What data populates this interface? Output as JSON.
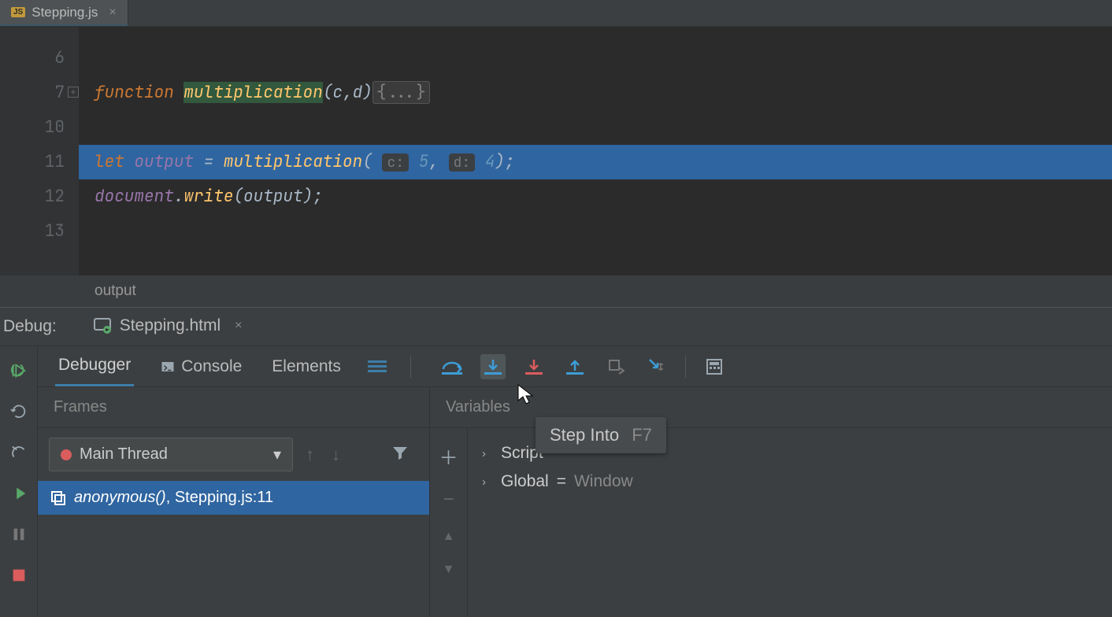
{
  "editor": {
    "tab": {
      "filename": "Stepping.js"
    },
    "lines": [
      {
        "num": "6"
      },
      {
        "num": "7"
      },
      {
        "num": "10"
      },
      {
        "num": "11"
      },
      {
        "num": "12"
      },
      {
        "num": "13"
      }
    ],
    "tokens": {
      "function_kw": "function",
      "fn_name": "multiplication",
      "fn_params": "(c,d)",
      "fold": "{...}",
      "let_kw": "let",
      "output_var": "output",
      "eq": " = ",
      "call_name": "multiplication",
      "open": "(",
      "hint_c": "c:",
      "arg1": "5",
      "comma": ",",
      "hint_d": "d:",
      "arg2": "4",
      "close_semi": ");",
      "document": "document",
      "dot": ".",
      "write": "write",
      "open2": "(",
      "out_arg": "output",
      "close2_semi": ");"
    },
    "status": "output"
  },
  "debug": {
    "label": "Debug:",
    "run_tab": "Stepping.html",
    "panel_tabs": {
      "debugger": "Debugger",
      "console": "Console",
      "elements": "Elements"
    },
    "frames_title": "Frames",
    "vars_title": "Variables",
    "thread_dd": "Main Thread",
    "frame0": {
      "fn": "anonymous()",
      "loc": ", Stepping.js:11"
    },
    "vars": {
      "script": "Script",
      "global": "Global",
      "eq": "=",
      "win": "Window"
    },
    "tooltip": {
      "label": "Step Into",
      "shortcut": "F7"
    }
  }
}
